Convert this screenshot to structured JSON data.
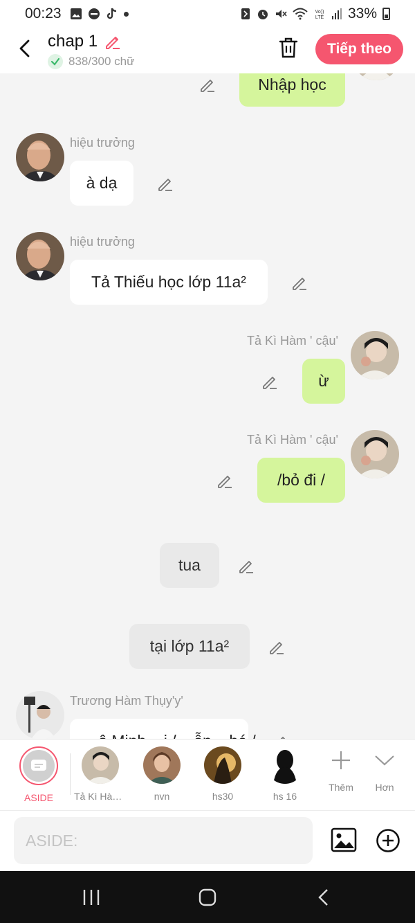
{
  "status_bar": {
    "time": "00:23",
    "battery": "33%",
    "left_icons": [
      "gallery-icon",
      "dnd-icon",
      "tiktok-icon",
      "dot"
    ],
    "right_icons": [
      "nfc-icon",
      "alarm-icon",
      "mute-icon",
      "wifi-icon",
      "volte-icon",
      "signal-icon",
      "battery-icon"
    ]
  },
  "header": {
    "title": "chap 1",
    "word_count": "838/300 chữ",
    "next_button": "Tiếp theo"
  },
  "colors": {
    "accent": "#f5566f",
    "green_bubble": "#d5f59c",
    "white_bubble": "#ffffff",
    "narration_bubble": "#e9e9e9",
    "background": "#f4f4f4"
  },
  "messages": [
    {
      "type": "right",
      "text": "Nhập học"
    },
    {
      "type": "left",
      "sender": "hiệu trưởng",
      "text": "à dạ"
    },
    {
      "type": "left",
      "sender": "hiệu trưởng",
      "text": "Tả Thiếu học lớp 11a²"
    },
    {
      "type": "right",
      "sender": "Tả Kì Hàm ' cậu'",
      "text": "ừ"
    },
    {
      "type": "right",
      "sender": "Tả Kì Hàm ' cậu'",
      "text": "/bỏ đi /"
    },
    {
      "type": "narration",
      "text": "tua"
    },
    {
      "type": "narration",
      "text": "tại lớp 11a²"
    },
    {
      "type": "left",
      "sender": "Trương Hàm Thụy'y'",
      "text": "...ô Minh ...i / ...ẫn ...hé /"
    }
  ],
  "characters": [
    {
      "name": "ASIDE",
      "selected": true
    },
    {
      "name": "Tả Kì Hàm..."
    },
    {
      "name": "nvn"
    },
    {
      "name": "hs30"
    },
    {
      "name": "hs 16"
    }
  ],
  "tools": {
    "more": "Thêm",
    "collapse": "Hơn"
  },
  "input": {
    "placeholder": "ASIDE:"
  }
}
